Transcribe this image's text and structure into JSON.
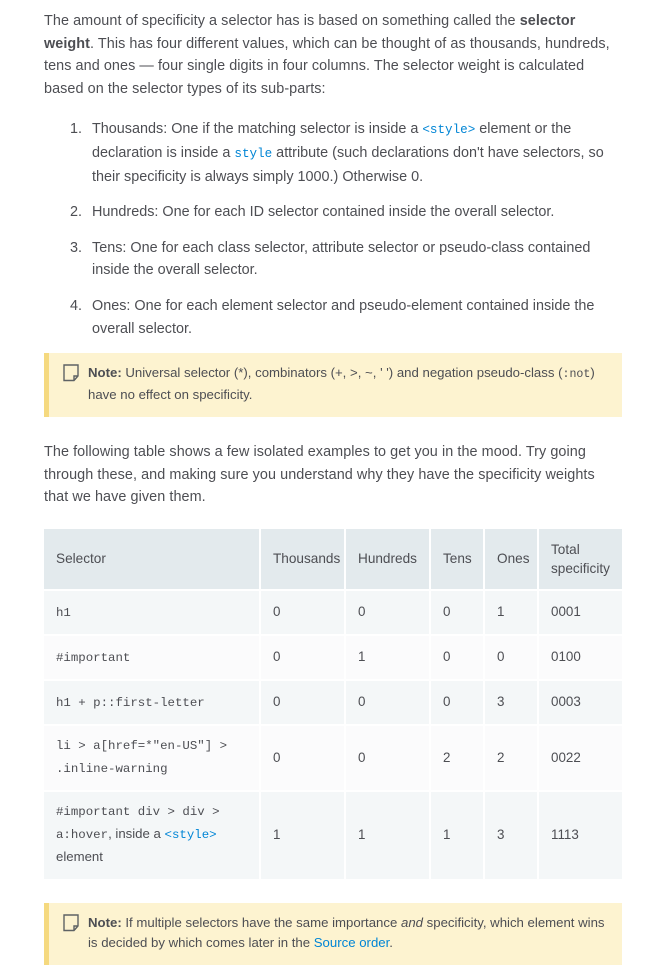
{
  "intro": {
    "part1": "The amount of specificity a selector has is based on something called the ",
    "bold": "selector weight",
    "part2": ". This has four different values, which can be thought of as thousands, hundreds, tens and ones — four single digits in four columns. The selector weight is calculated based on the selector types of its sub-parts:"
  },
  "list": {
    "item1": {
      "a": "Thousands: One if the matching selector is inside a ",
      "code1": "<style>",
      "b": " element or the declaration is inside a ",
      "code2": "style",
      "c": " attribute (such declarations don't have selectors, so their specificity is always simply 1000.) Otherwise 0."
    },
    "item2": "Hundreds: One for each ID selector contained inside the overall selector.",
    "item3": "Tens: One for each class selector, attribute selector or pseudo-class contained inside the overall selector.",
    "item4": "Ones: One for each element selector and pseudo-element contained inside the overall selector."
  },
  "note_top": {
    "label": "Note",
    "colon": ":",
    "text_a": " Universal selector (*), combinators (+, >, ~, ' ') and negation pseudo-class (",
    "code": ":not",
    "text_b": ") have no effect on specificity."
  },
  "table_intro": "The following table shows a few isolated examples to get you in the mood. Try going through these, and making sure you understand why they have the specificity weights that we have given them.",
  "table": {
    "headers": [
      "Selector",
      "Thousands",
      "Hundreds",
      "Tens",
      "Ones",
      "Total specificity"
    ],
    "rows": [
      {
        "selector_mono": "h1",
        "selector_sans": "",
        "selector_style": "",
        "selector_tail": "",
        "thousands": "0",
        "hundreds": "0",
        "tens": "0",
        "ones": "1",
        "total": "0001"
      },
      {
        "selector_mono": "#important",
        "selector_sans": "",
        "selector_style": "",
        "selector_tail": "",
        "thousands": "0",
        "hundreds": "1",
        "tens": "0",
        "ones": "0",
        "total": "0100"
      },
      {
        "selector_mono": "h1 + p::first-letter",
        "selector_sans": "",
        "selector_style": "",
        "selector_tail": "",
        "thousands": "0",
        "hundreds": "0",
        "tens": "0",
        "ones": "3",
        "total": "0003"
      },
      {
        "selector_mono": "li > a[href=*\"en-US\"] > .inline-warning",
        "selector_sans": "",
        "selector_style": "",
        "selector_tail": "",
        "thousands": "0",
        "hundreds": "0",
        "tens": "2",
        "ones": "2",
        "total": "0022"
      },
      {
        "selector_mono": "#important div > div > a:hover",
        "selector_sans": ", inside a ",
        "selector_style": "<style>",
        "selector_tail": " element",
        "thousands": "1",
        "hundreds": "1",
        "tens": "1",
        "ones": "3",
        "total": "1113"
      }
    ]
  },
  "note_bottom": {
    "label": "Note",
    "colon": ":",
    "text_a": " If multiple selectors have the same importance ",
    "em": "and",
    "text_b": " specificity, which element wins is decided by which comes later in the ",
    "link": "Source order",
    "text_c": "."
  }
}
